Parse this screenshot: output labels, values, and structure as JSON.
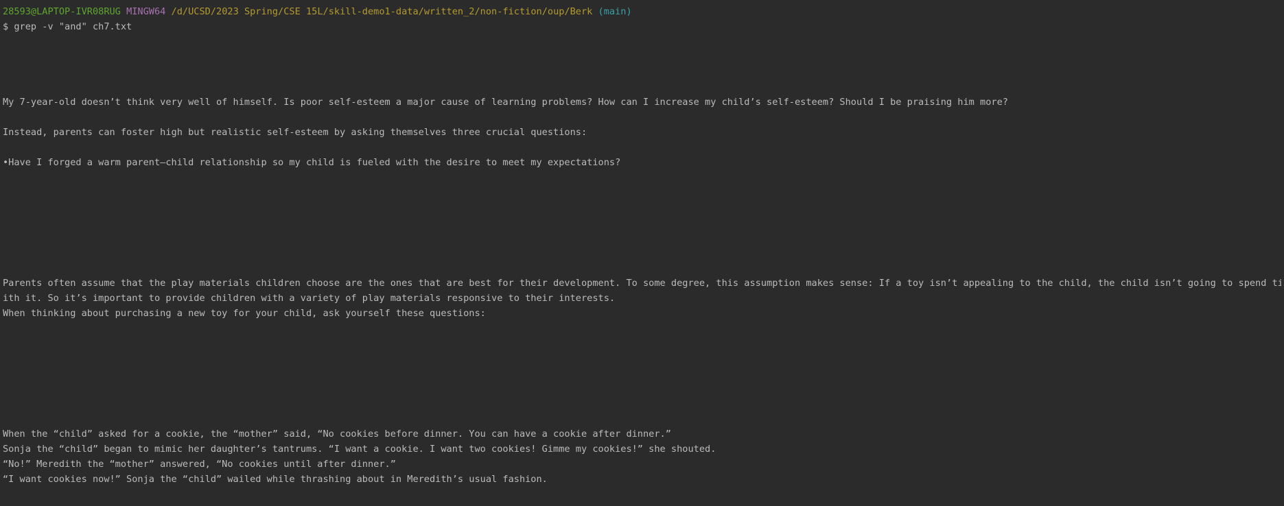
{
  "colors": {
    "background": "#2b2b2b",
    "text": "#bbbbbb",
    "prompt_user": "#5fa530",
    "prompt_system": "#a672b0",
    "prompt_path": "#b49b2e",
    "prompt_branch": "#3aa2a8"
  },
  "prompt": {
    "user_host": "28593@LAPTOP-IVR08RUG",
    "system": "MINGW64",
    "path": "/d/UCSD/2023 Spring/CSE 15L/skill-demo1-data/written_2/non-fiction/oup/Berk",
    "branch": "(main)"
  },
  "command": "$ grep -v \"and\" ch7.txt",
  "output": {
    "l01": "",
    "l02": "",
    "l03": "",
    "l04": "",
    "l05": "My 7-year-old doesn’t think very well of himself. Is poor self-esteem a major cause of learning problems? How can I increase my child’s self-esteem? Should I be praising him more?",
    "l06": "",
    "l07": "Instead, parents can foster high but realistic self-esteem by asking themselves three crucial questions:",
    "l08": "",
    "l09": "•Have I forged a warm parent–child relationship so my child is fueled with the desire to meet my expectations?",
    "l10": "",
    "l11": "",
    "l12": "",
    "l13": "",
    "l14": "",
    "l15": "",
    "l16": "",
    "l17": "Parents often assume that the play materials children choose are the ones that are best for their development. To some degree, this assumption makes sense: If a toy isn’t appealing to the child, the child isn’t going to spend time w",
    "l18": "ith it. So it’s important to provide children with a variety of play materials responsive to their interests.",
    "l19": "When thinking about purchasing a new toy for your child, ask yourself these questions:",
    "l20": "",
    "l21": "",
    "l22": "",
    "l23": "",
    "l24": "",
    "l25": "",
    "l26": "",
    "l27": "When the “child” asked for a cookie, the “mother” said, “No cookies before dinner. You can have a cookie after dinner.”",
    "l28": "Sonja the “child” began to mimic her daughter’s tantrums. “I want a cookie. I want two cookies! Gimme my cookies!” she shouted.",
    "l29": "“No!” Meredith the “mother” answered, “No cookies until after dinner.”",
    "l30": "“I want cookies now!” Sonja the “child” wailed while thrashing about in Meredith’s usual fashion."
  }
}
